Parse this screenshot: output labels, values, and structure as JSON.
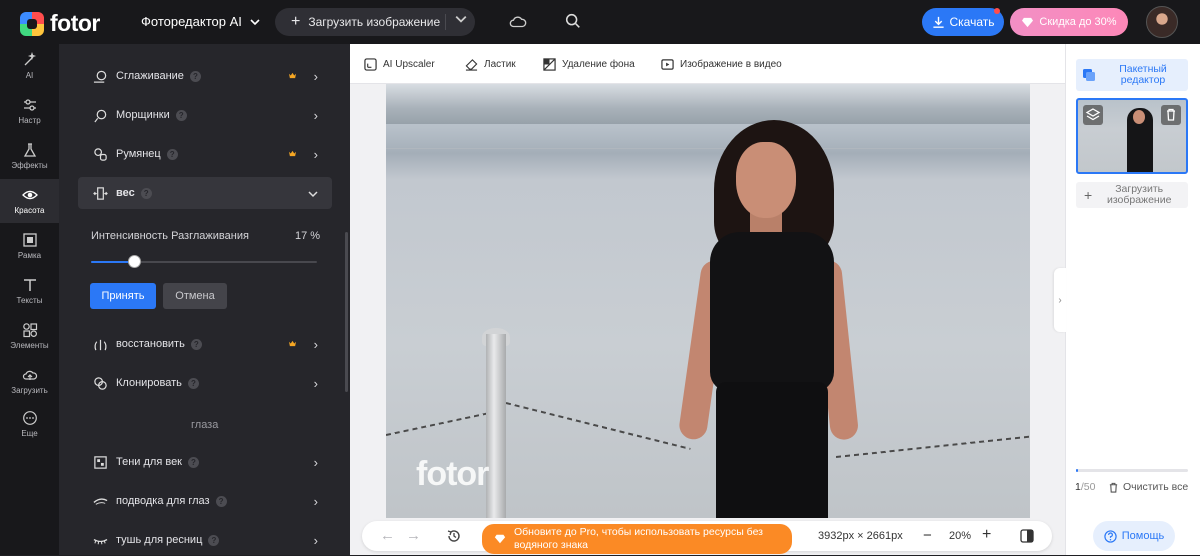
{
  "header": {
    "logo_text": "fotor",
    "editor_menu_label": "Фоторедактор AI",
    "upload_label": "Загрузить изображение",
    "download_label": "Скачать",
    "discount_label": "Скидка до 30%"
  },
  "iconbar": {
    "items": [
      {
        "label": "AI",
        "icon": "ai-wand-icon"
      },
      {
        "label": "Настр",
        "icon": "sliders-icon"
      },
      {
        "label": "Эффекты",
        "icon": "flask-icon"
      },
      {
        "label": "Красота",
        "icon": "eye-icon"
      },
      {
        "label": "Рамка",
        "icon": "frame-icon"
      },
      {
        "label": "Тексты",
        "icon": "text-icon"
      },
      {
        "label": "Элементы",
        "icon": "shapes-icon"
      },
      {
        "label": "Загрузить",
        "icon": "upload-icon"
      },
      {
        "label": "Еще",
        "icon": "more-icon"
      }
    ],
    "active_index": 3
  },
  "panel": {
    "rows_top": [
      {
        "label": "Сглаживание",
        "icon": "smooth-icon",
        "pro": true
      },
      {
        "label": "Морщинки",
        "icon": "wrinkle-icon",
        "pro": false
      },
      {
        "label": "Румянец",
        "icon": "blush-icon",
        "pro": true
      }
    ],
    "expanded_row": {
      "label": "вес",
      "icon": "weight-icon"
    },
    "intensity_label": "Интенсивность Разглаживания",
    "intensity_value": "17 %",
    "intensity_fraction": 0.19,
    "apply_label": "Принять",
    "cancel_label": "Отмена",
    "rows_mid": [
      {
        "label": "восстановить",
        "icon": "restore-icon",
        "pro": true
      },
      {
        "label": "Клонировать",
        "icon": "clone-icon",
        "pro": false
      }
    ],
    "section_eyes": "глаза",
    "rows_eyes": [
      {
        "label": "Тени для век",
        "icon": "eyeshadow-icon",
        "pro": false
      },
      {
        "label": "подводка для глаз",
        "icon": "eyeliner-icon",
        "pro": false
      },
      {
        "label": "тушь для ресниц",
        "icon": "mascara-icon",
        "pro": false
      }
    ]
  },
  "tools": [
    {
      "label": "AI Upscaler",
      "icon": "upscale-icon"
    },
    {
      "label": "Ластик",
      "icon": "eraser-icon"
    },
    {
      "label": "Удаление фона",
      "icon": "bg-remove-icon"
    },
    {
      "label": "Изображение в видео",
      "icon": "video-icon"
    }
  ],
  "canvas": {
    "watermark": "fotor"
  },
  "bottom": {
    "promo_text": "Обновите до Pro, чтобы использовать ресурсы без водяного знака",
    "dimensions": "3932px × 2661px",
    "zoom": "20%",
    "zoom_minus": "−",
    "zoom_plus": "+"
  },
  "right_panel": {
    "batch_label": "Пакетный редактор",
    "upload_label": "Загрузить изображение",
    "count_current": "1",
    "count_total": "/50",
    "upload_progress": 0.02,
    "clear_label": "Очистить все",
    "help_label": "Помощь"
  },
  "colors": {
    "accent": "#2b78f6",
    "promo": "#fb8a25",
    "pro_crown": "#f5a623"
  }
}
